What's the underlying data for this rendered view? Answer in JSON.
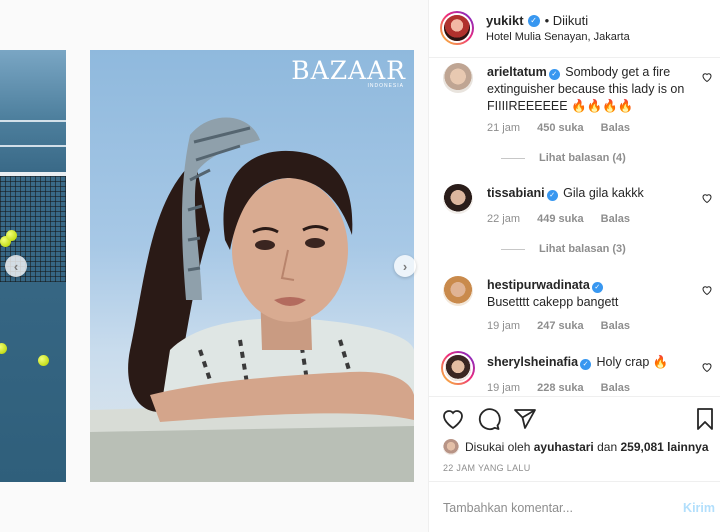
{
  "post": {
    "username": "yukikt",
    "follow_status": "• Diikuti",
    "location": "Hotel Mulia Senayan, Jakarta"
  },
  "media": {
    "brand": "BAZAAR",
    "brand_sub": "INDONESIA",
    "prev_arrow": "‹",
    "next_arrow": "›"
  },
  "comments": [
    {
      "username": "arieltatum",
      "verified": true,
      "text": "Sombody get a fire extinguisher because this lady is on FIIIIREEEEEE 🔥🔥🔥🔥",
      "time": "21 jam",
      "likes": "450 suka",
      "reply": "Balas",
      "view_replies": "Lihat balasan (4)"
    },
    {
      "username": "tissabiani",
      "verified": true,
      "text": "Gila gila kakkk",
      "time": "22 jam",
      "likes": "449 suka",
      "reply": "Balas",
      "view_replies": "Lihat balasan (3)"
    },
    {
      "username": "hestipurwadinata",
      "verified": true,
      "text": "Busetttt cakepp bangett",
      "time": "19 jam",
      "likes": "247 suka",
      "reply": "Balas"
    },
    {
      "username": "sherylsheinafia",
      "verified": true,
      "text": "Holy crap 🔥",
      "time": "19 jam",
      "likes": "228 suka",
      "reply": "Balas"
    }
  ],
  "actions": {
    "liked_prefix": "Disukai oleh",
    "liked_user": "ayuhastari",
    "liked_and": "dan",
    "liked_count": "259,081 lainnya",
    "timestamp": "22 JAM YANG LALU",
    "comment_placeholder": "Tambahkan komentar...",
    "post_label": "Kirim"
  },
  "colors": {
    "verified": "#3897f0",
    "secondary_text": "#8e8e8e",
    "post_disabled": "#b2dffc"
  },
  "icons": [
    "heart-icon",
    "comment-icon",
    "share-icon",
    "bookmark-icon",
    "verified-icon",
    "chevron-left-icon",
    "chevron-right-icon"
  ]
}
